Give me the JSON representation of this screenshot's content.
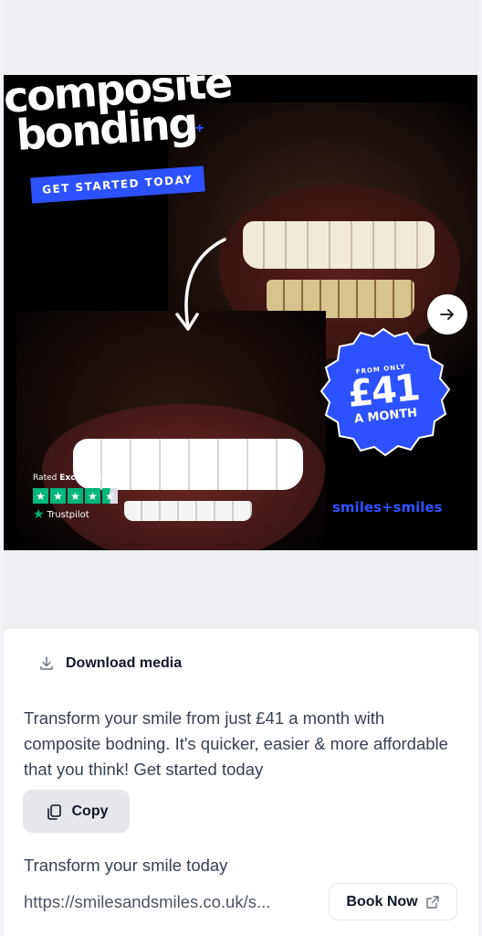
{
  "creative": {
    "headline_line1": "composite",
    "headline_line2": "bonding",
    "plus_symbol": "+",
    "cta_banner": "GET STARTED TODAY",
    "price_from": "FROM ONLY",
    "price_amount": "£41",
    "price_period": "A MONTH",
    "rating_prefix": "Rated",
    "rating_word": "Excellent",
    "rating_stars": 4.5,
    "trustpilot_label": "Trustpilot",
    "brand": "smiles+smiles",
    "next_icon": "arrow-right-icon",
    "brand_color": "#2e51ff",
    "star_color": "#00b67a"
  },
  "actions": {
    "download_label": "Download media",
    "download_icon": "download-icon",
    "copy_label": "Copy",
    "copy_icon": "copy-icon"
  },
  "ad": {
    "primary_text": "Transform your smile from just £41 a month with composite bodning. It's quicker, easier & more affordable that you think! Get started today",
    "headline": "Transform your smile today",
    "link_url": "https://smilesandsmiles.co.uk/s...",
    "cta_label": "Book Now",
    "cta_icon": "external-link-icon"
  }
}
